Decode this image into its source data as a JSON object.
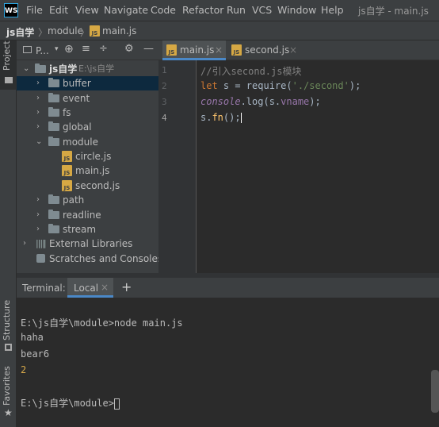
{
  "app": {
    "logo_text": "WS",
    "window_title": "js自学 - main.js"
  },
  "menu": [
    "File",
    "Edit",
    "View",
    "Navigate",
    "Code",
    "Refactor",
    "Run",
    "VCS",
    "Window",
    "Help"
  ],
  "breadcrumb": {
    "root": "js自学",
    "folder": "module",
    "file": "main.js"
  },
  "left_stripe": {
    "project": "Project",
    "structure": "Structure",
    "favorites": "Favorites"
  },
  "project": {
    "title": "P...",
    "root_name": "js自学",
    "root_path": "E:\\js自学",
    "folders": [
      "buffer",
      "event",
      "fs",
      "global",
      "module",
      "path",
      "readline",
      "stream"
    ],
    "module_files": [
      "circle.js",
      "main.js",
      "second.js"
    ],
    "external": "External Libraries",
    "scratches": "Scratches and Consoles"
  },
  "editor": {
    "tabs": [
      "main.js",
      "second.js"
    ],
    "line_numbers": [
      "1",
      "2",
      "3",
      "4"
    ],
    "code": {
      "l1": "//引入second.js模块",
      "l2_kw": "let",
      "l2_a": " s = require(",
      "l2_str": "'./second'",
      "l2_b": ");",
      "l3_obj": "console",
      "l3_a": ".log(s.",
      "l3_prop": "vname",
      "l3_b": ");",
      "l4_a": "s.",
      "l4_fn": "fn",
      "l4_b": "();"
    }
  },
  "terminal": {
    "label": "Terminal:",
    "tab": "Local",
    "add": "+",
    "lines": [
      "E:\\js自学\\module>node main.js",
      "haha",
      "bear6",
      "2"
    ],
    "prompt": "E:\\js自学\\module>"
  },
  "colors": {
    "keyword": "#cc7832",
    "string": "#6a8759",
    "comment": "#808080",
    "property": "#9876aa",
    "function": "#ffc66d",
    "number": "#d6a84a"
  }
}
